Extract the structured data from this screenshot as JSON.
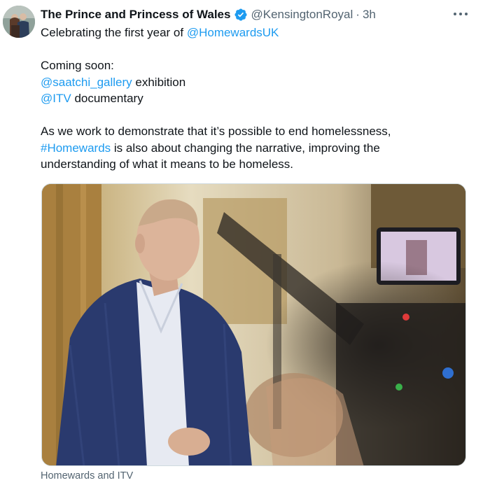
{
  "tweet": {
    "author": {
      "display_name": "The Prince and Princess of Wales",
      "handle": "@KensingtonRoyal",
      "verified": true,
      "avatar_icon": "profile-photo"
    },
    "separator": "·",
    "time": "3h",
    "more_icon": "more-options-icon",
    "text": {
      "line1_prefix": "Celebrating the first year of ",
      "line1_mention": "@HomewardsUK",
      "coming_soon": "Coming soon:",
      "mention_saatchi": "@saatchi_gallery",
      "saatchi_suffix": " exhibition",
      "mention_itv": "@ITV",
      "itv_suffix": " documentary",
      "para_line1": "As we work to demonstrate that it’s possible to end homelessness,",
      "hashtag": "#Homewards",
      "para_line2_suffix": " is also about changing the narrative, improving the",
      "para_line3": "understanding of what it means to be homeless."
    },
    "media": {
      "description_icon": "photo-media",
      "caption": "Homewards and ITV"
    }
  },
  "colors": {
    "link": "#1d9bf0",
    "text": "#0f1419",
    "secondary": "#536471",
    "verified_badge": "#1d9bf0"
  }
}
